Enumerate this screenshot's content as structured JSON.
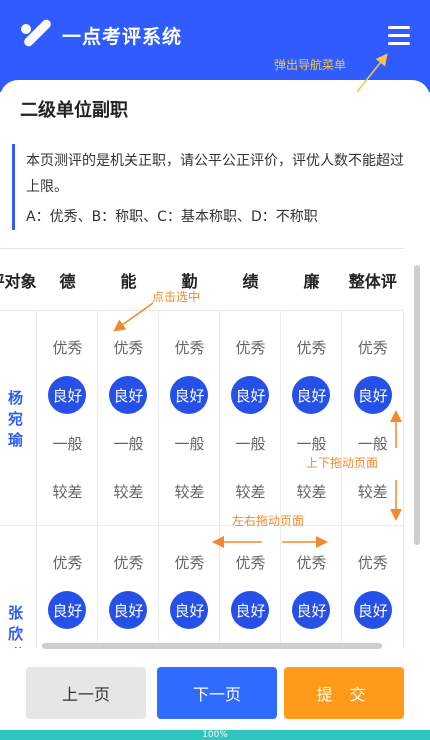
{
  "app": {
    "title": "一点考评系统"
  },
  "hints": {
    "menu": "弹出导航菜单",
    "select": "点击选中",
    "vertical": "上下拖动页面",
    "horizontal": "左右拖动页面"
  },
  "page": {
    "title": "二级单位副职"
  },
  "notice": {
    "line1": "本页测评的是机关正职，请公平公正评价，评优人数不能超过上限。",
    "line2": "A：优秀、B：称职、C：基本称职、D：不称职"
  },
  "table": {
    "headers": [
      "评对象",
      "德",
      "能",
      "勤",
      "绩",
      "廉",
      "整体评"
    ],
    "options": [
      "优秀",
      "良好",
      "一般",
      "较差"
    ],
    "rows": [
      {
        "name": "杨宛瑜",
        "selected": "良好"
      },
      {
        "name": "张欣琪",
        "selected": "良好"
      }
    ]
  },
  "footer": {
    "prev": "上一页",
    "next": "下一页",
    "submit": "提 交"
  },
  "progress": {
    "label": "100%",
    "value": 1.0
  },
  "colors": {
    "primary": "#2f5bff",
    "accent": "#ff9a1a",
    "progress": "#30c6c0",
    "hint": "#f3892e"
  }
}
